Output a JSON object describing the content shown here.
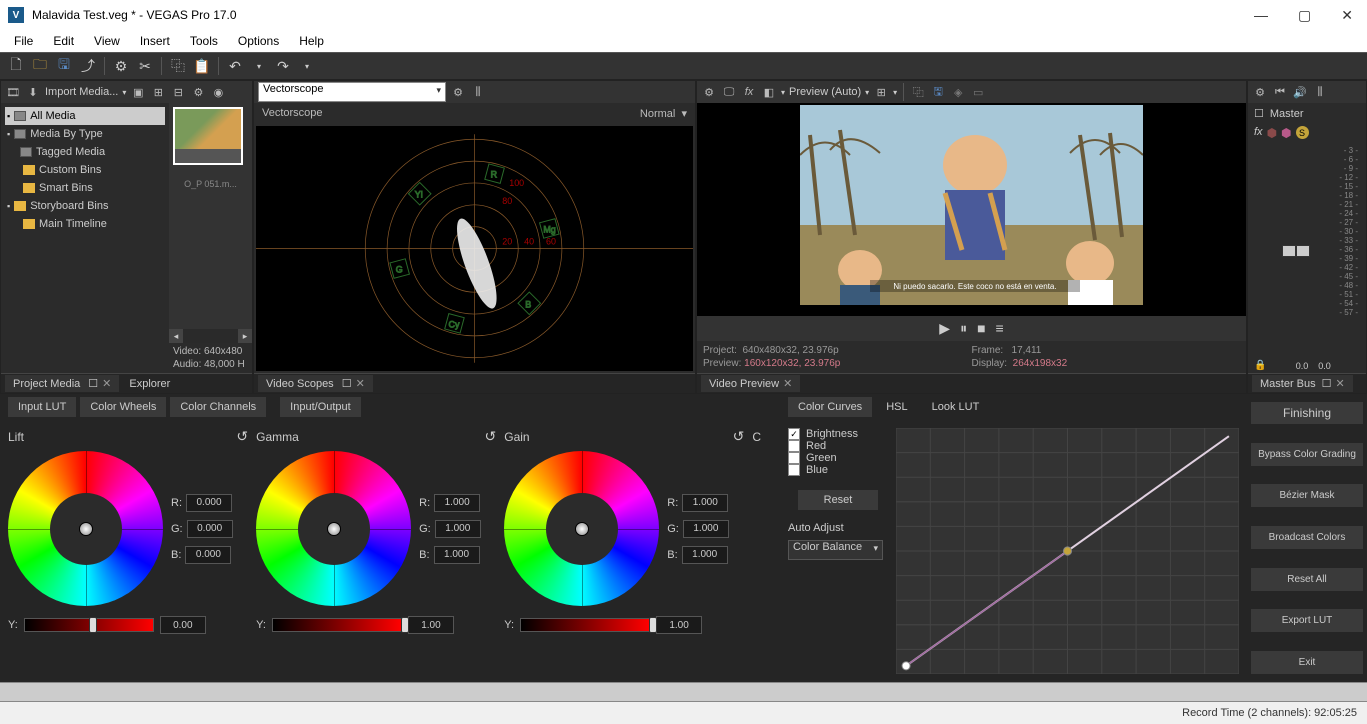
{
  "title": "Malavida Test.veg * - VEGAS Pro 17.0",
  "menubar": [
    "File",
    "Edit",
    "View",
    "Insert",
    "Tools",
    "Options",
    "Help"
  ],
  "project_media": {
    "import_label": "Import Media...",
    "tree": [
      {
        "label": "All Media",
        "type": "media",
        "selected": true,
        "indent": 0
      },
      {
        "label": "Media By Type",
        "type": "media",
        "indent": 0
      },
      {
        "label": "Tagged Media",
        "type": "media",
        "indent": 0
      },
      {
        "label": "Custom Bins",
        "type": "folder",
        "indent": 1
      },
      {
        "label": "Smart Bins",
        "type": "folder",
        "indent": 1
      },
      {
        "label": "Storyboard Bins",
        "type": "folder",
        "indent": 0
      },
      {
        "label": "Main Timeline",
        "type": "folder",
        "indent": 1
      }
    ],
    "thumb_label": "O_P 051.m...",
    "media_info_video": "Video: 640x480",
    "media_info_audio": "Audio: 48,000 H",
    "tab_project": "Project Media",
    "tab_explorer": "Explorer"
  },
  "scopes": {
    "dropdown": "Vectorscope",
    "title": "Vectorscope",
    "mode": "Normal",
    "tab": "Video Scopes",
    "ticks": [
      100,
      80,
      60,
      40,
      20
    ],
    "targets": [
      "R",
      "Mg",
      "B",
      "Cy",
      "G",
      "Yl"
    ]
  },
  "preview": {
    "quality_label": "Preview (Auto)",
    "project_label": "Project:",
    "project_val": "640x480x32, 23.976p",
    "preview_label": "Preview:",
    "preview_val": "160x120x32, 23.976p",
    "frame_label": "Frame:",
    "frame_val": "17,411",
    "display_label": "Display:",
    "display_val": "264x198x32",
    "tab": "Video Preview"
  },
  "mixer": {
    "master_label": "Master",
    "scale": [
      "- 3 -",
      "- 6 -",
      "- 9 -",
      "- 12 -",
      "- 15 -",
      "- 18 -",
      "- 21 -",
      "- 24 -",
      "- 27 -",
      "- 30 -",
      "- 33 -",
      "- 36 -",
      "- 39 -",
      "- 42 -",
      "- 45 -",
      "- 48 -",
      "- 51 -",
      "- 54 -",
      "- 57 -"
    ],
    "readout": [
      "0.0",
      "0.0"
    ],
    "tab": "Master Bus"
  },
  "color_grading": {
    "left_tabs": [
      "Input LUT",
      "Color Wheels",
      "Color Channels",
      "Input/Output"
    ],
    "active_left_tab": "Color Wheels",
    "wheels": [
      {
        "name": "Lift",
        "r": "0.000",
        "g": "0.000",
        "b": "0.000",
        "y": "0.00",
        "handle": 50
      },
      {
        "name": "Gamma",
        "r": "1.000",
        "g": "1.000",
        "b": "1.000",
        "y": "1.00",
        "handle": 100
      },
      {
        "name": "Gain",
        "r": "1.000",
        "g": "1.000",
        "b": "1.000",
        "y": "1.00",
        "handle": 100
      }
    ],
    "curves_tabs": [
      "Color Curves",
      "HSL",
      "Look LUT"
    ],
    "active_curves_tab": "Color Curves",
    "curve_channels": [
      {
        "label": "Brightness",
        "checked": true
      },
      {
        "label": "Red",
        "checked": false
      },
      {
        "label": "Green",
        "checked": false
      },
      {
        "label": "Blue",
        "checked": false
      }
    ],
    "reset_btn": "Reset",
    "auto_adjust_label": "Auto Adjust",
    "auto_adjust_value": "Color Balance",
    "finishing_tab": "Finishing",
    "finishing_buttons": [
      "Bypass Color Grading",
      "Bézier Mask",
      "Broadcast Colors",
      "Reset All",
      "Export LUT",
      "Exit"
    ]
  },
  "statusbar": "Record Time (2 channels): 92:05:25"
}
